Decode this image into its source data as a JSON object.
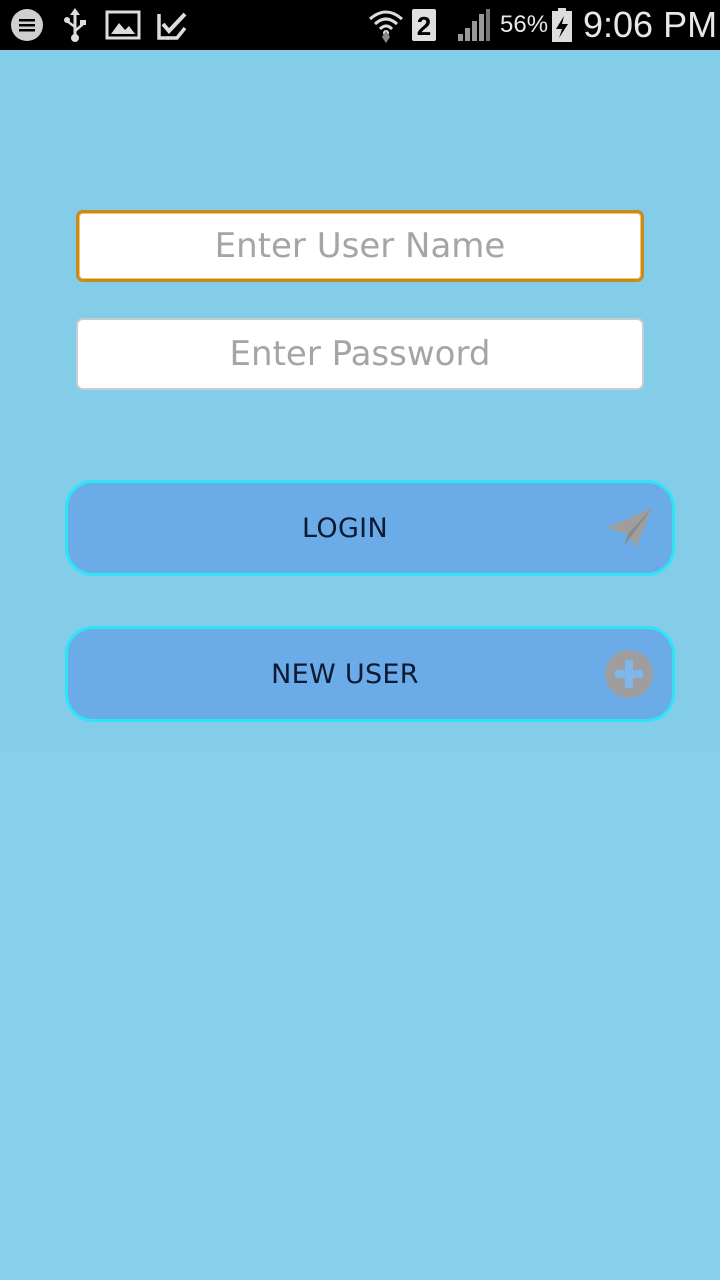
{
  "status_bar": {
    "icons": [
      "chat-bubble-icon",
      "usb-icon",
      "gallery-icon",
      "task-check-icon",
      "wifi-icon",
      "sim-2-icon",
      "signal-icon",
      "battery-charging-icon"
    ],
    "sim_label": "2",
    "battery_percent": "56%",
    "time": "9:06 PM"
  },
  "form": {
    "username_placeholder": "Enter User Name",
    "password_placeholder": "Enter Password",
    "login_label": "LOGIN",
    "login_icon": "paper-plane-icon",
    "new_user_label": "NEW USER",
    "new_user_icon": "add-circle-icon"
  },
  "colors": {
    "background": "#87d1ec",
    "button_fill": "#6aabe8",
    "button_border": "#2ee4f7",
    "focus_border": "#c88a1a",
    "icon_gray": "#9e9e9e"
  }
}
